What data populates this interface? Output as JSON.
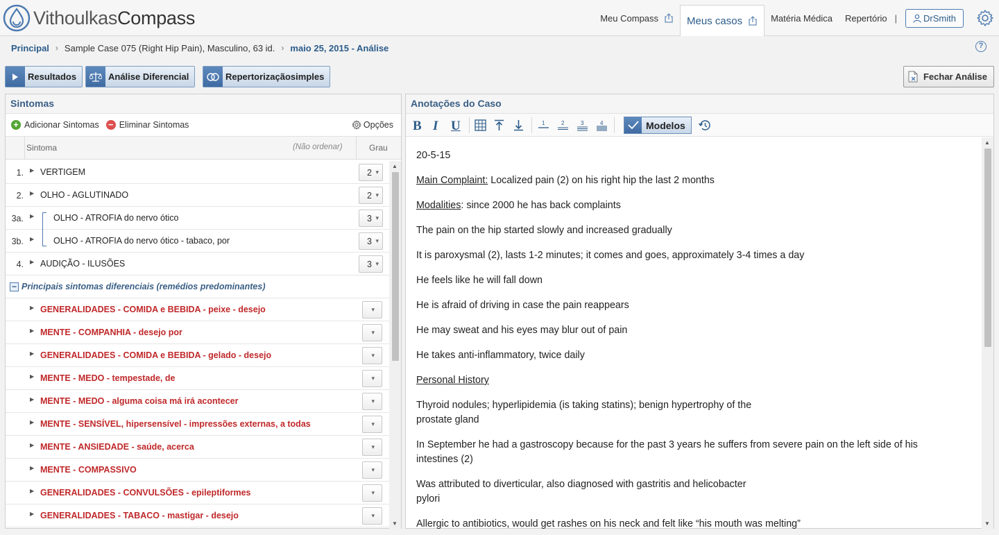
{
  "header": {
    "brand_light": "Vithoulkas",
    "brand_bold": "Compass",
    "nav": [
      {
        "label": "Meu Compass"
      },
      {
        "label": "Meus casos"
      },
      {
        "label": "Matéria Médica"
      },
      {
        "label": "Repertório"
      }
    ],
    "separator": "|",
    "user": "DrSmith"
  },
  "breadcrumb": {
    "home": "Principal",
    "case": "Sample Case 075 (Right Hip Pain), Masculino, 63 id.",
    "date": "maio 25, 2015 - Análise",
    "help": "?"
  },
  "toolbar": {
    "results": "Resultados",
    "differential": "Análise Diferencial",
    "simple": "Repertorizaçãosimples",
    "close": "Fechar Análise"
  },
  "symptoms_panel": {
    "title": "Sintomas",
    "add": "Adicionar Sintomas",
    "remove": "Eliminar Sintomas",
    "options": "Opções",
    "col_symptom": "Sintoma",
    "col_sort": "(Não ordenar)",
    "col_grade": "Grau",
    "rows": [
      {
        "num": "1.",
        "label": "VERTIGEM",
        "grade": "2"
      },
      {
        "num": "2.",
        "label": "OLHO - AGLUTINADO",
        "grade": "2"
      },
      {
        "num": "3a.",
        "label": "OLHO - ATROFIA do nervo ótico",
        "grade": "3"
      },
      {
        "num": "3b.",
        "label": "OLHO - ATROFIA do nervo ótico - tabaco, por",
        "grade": "3"
      },
      {
        "num": "4.",
        "label": "AUDIÇÃO - ILUSÕES",
        "grade": "3"
      }
    ],
    "group_label": "Principais sintomas diferenciais (remédios predominantes)",
    "group_minus": "−",
    "differential_rows": [
      "GENERALIDADES - COMIDA e BEBIDA - peixe - desejo",
      "MENTE - COMPANHIA - desejo por",
      "GENERALIDADES - COMIDA e BEBIDA - gelado - desejo",
      "MENTE - MEDO - tempestade, de",
      "MENTE - MEDO - alguma coisa má irá acontecer",
      "MENTE - SENSÍVEL, hipersensível - impressões externas, a todas",
      "MENTE - ANSIEDADE - saúde, acerca",
      "MENTE - COMPASSIVO",
      "GENERALIDADES - CONVULSÕES - epileptiformes",
      "GENERALIDADES - TABACO - mastigar - desejo"
    ]
  },
  "notes_panel": {
    "title": "Anotações do Caso",
    "format": {
      "bold": "B",
      "italic": "I",
      "underline": "U"
    },
    "models": "Modelos",
    "content": {
      "date": "20-5-15",
      "main_label": "Main Complaint:",
      "main_text": " Localized pain (2) on his right hip the last 2 months",
      "mod_label": "Modalities",
      "mod_text": ": since 2000 he has back complaints",
      "p1": "The pain on the hip started slowly and increased gradually",
      "p2": "It is paroxysmal (2), lasts 1-2 minutes; it comes and goes, approximately 3-4 times a day",
      "p3": "He feels like he will fall down",
      "p4": "He is afraid of driving in case the pain reappears",
      "p5": "He may sweat and his eyes may blur out of pain",
      "p6": "He takes anti-inflammatory, twice daily",
      "history_label": "Personal History",
      "h1a": "Thyroid nodules; hyperlipidemia (is taking statins); benign hypertrophy of the",
      "h1b": "prostate gland",
      "h2a": "In September he had a gastroscopy because for the past 3 years he suffers from severe pain on the left side of his",
      "h2b": "intestines (2)",
      "h3a": "Was attributed to diverticular, also diagnosed with gastritis and helicobacter",
      "h3b": "pylori",
      "h4": "Allergic to antibiotics, would get rashes on his neck and felt like “his mouth was melting”"
    }
  }
}
